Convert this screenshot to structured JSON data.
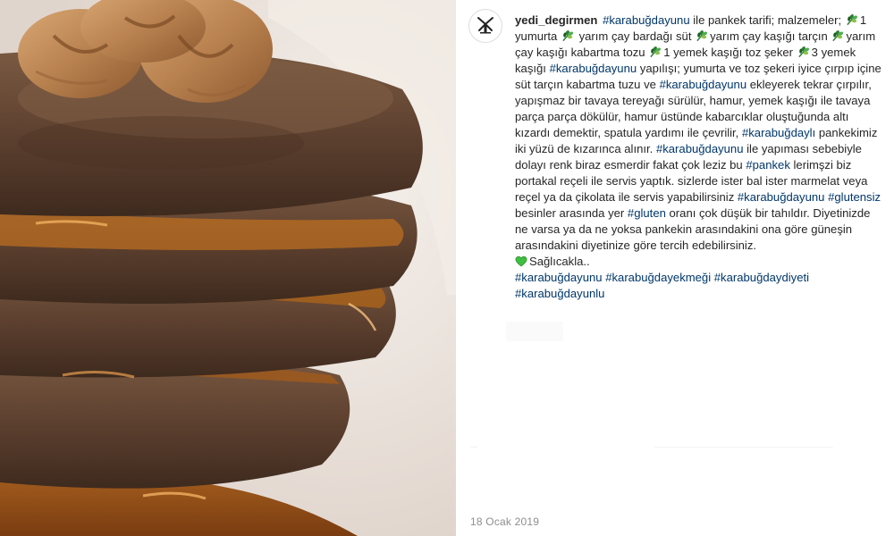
{
  "post": {
    "username": "yedi_degirmen",
    "date": "18 Ocak 2019",
    "caption": [
      {
        "t": "hashtag",
        "v": "#karabuğdayunu"
      },
      {
        "t": "text",
        "v": " ile pankek tarifi; malzemeler; "
      },
      {
        "t": "icon",
        "v": "wheat-icon"
      },
      {
        "t": "text",
        "v": "1 yumurta "
      },
      {
        "t": "icon",
        "v": "wheat-icon"
      },
      {
        "t": "text",
        "v": " yarım çay bardağı süt "
      },
      {
        "t": "icon",
        "v": "wheat-icon"
      },
      {
        "t": "text",
        "v": "yarım çay kaşığı tarçın "
      },
      {
        "t": "icon",
        "v": "wheat-icon"
      },
      {
        "t": "text",
        "v": "yarım çay kaşığı kabartma tozu "
      },
      {
        "t": "icon",
        "v": "wheat-icon"
      },
      {
        "t": "text",
        "v": "1 yemek kaşığı toz şeker "
      },
      {
        "t": "icon",
        "v": "wheat-icon"
      },
      {
        "t": "text",
        "v": "3 yemek kaşığı "
      },
      {
        "t": "hashtag",
        "v": "#karabuğdayunu"
      },
      {
        "t": "text",
        "v": " yapılışı; yumurta ve toz şekeri iyice çırpıp içine süt tarçın kabartma tuzu ve "
      },
      {
        "t": "hashtag",
        "v": "#karabuğdayunu"
      },
      {
        "t": "text",
        "v": " ekleyerek tekrar çırpılır, yapışmaz bir tavaya tereyağı sürülür, hamur, yemek kaşığı ile tavaya parça parça dökülür, hamur üstünde kabarcıklar oluştuğunda altı kızardı demektir, spatula yardımı ile çevrilir, "
      },
      {
        "t": "hashtag",
        "v": "#karabuğdaylı"
      },
      {
        "t": "text",
        "v": " pankekimiz iki yüzü de kızarınca alınır. "
      },
      {
        "t": "hashtag",
        "v": "#karabuğdayunu"
      },
      {
        "t": "text",
        "v": " ile yapıması sebebiyle dolayı renk biraz esmerdir fakat çok leziz bu "
      },
      {
        "t": "hashtag",
        "v": "#pankek"
      },
      {
        "t": "text",
        "v": " lerimşzi biz portakal reçeli ile servis yaptık. sizlerde ister bal ister marmelat veya reçel ya da çikolata ile servis yapabilirsiniz "
      },
      {
        "t": "hashtag",
        "v": "#karabuğdayunu"
      },
      {
        "t": "text",
        "v": " "
      },
      {
        "t": "hashtag",
        "v": "#glutensiz"
      },
      {
        "t": "text",
        "v": " besinler arasında yer "
      },
      {
        "t": "hashtag",
        "v": "#gluten"
      },
      {
        "t": "text",
        "v": " oranı çok düşük bir tahıldır. Diyetinizde ne varsa ya da ne yoksa pankekin arasındakini ona göre güneşin arasındakini diyetinize göre tercih edebilirsiniz. "
      },
      {
        "t": "break"
      },
      {
        "t": "icon",
        "v": "green-heart-icon"
      },
      {
        "t": "text",
        "v": "Sağlıcakla.."
      },
      {
        "t": "break"
      },
      {
        "t": "hashtag",
        "v": "#karabuğdayunu"
      },
      {
        "t": "text",
        "v": " "
      },
      {
        "t": "hashtag",
        "v": "#karabuğdayekmeği"
      },
      {
        "t": "text",
        "v": " "
      },
      {
        "t": "hashtag",
        "v": "#karabuğdaydiyeti"
      },
      {
        "t": "text",
        "v": " "
      },
      {
        "t": "hashtag",
        "v": "#karabuğdayunlu"
      }
    ]
  },
  "colors": {
    "hashtag": "#00376b",
    "text": "#262626",
    "muted": "#8e8e8e",
    "wheat_green": "#2e7d32",
    "heart_green": "#3fbf3f",
    "pancake": "#6a4a32",
    "syrup": "#b8651a"
  },
  "photo": {
    "subject": "stack of buckwheat pancakes with orange marmalade syrup and walnuts"
  }
}
